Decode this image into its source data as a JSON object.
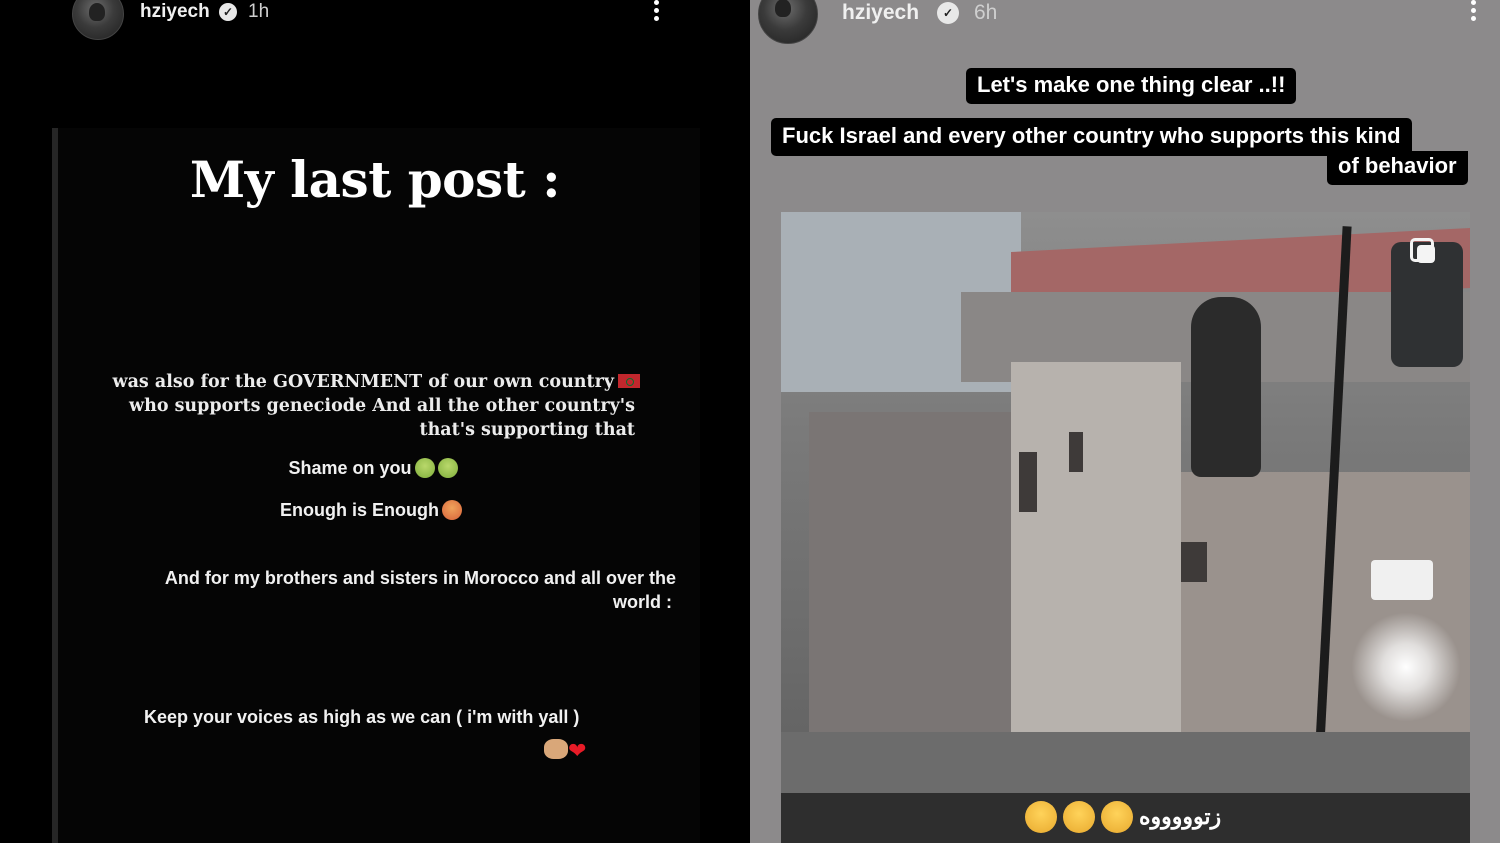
{
  "left_story": {
    "username": "hziyech",
    "time": "1h",
    "title": "My last post  :",
    "paragraph_lines": [
      "was also for the GOVERNMENT of our own country",
      "who supports geneciode  And all the other country's",
      "that's supporting that"
    ],
    "shame_text": "Shame on you",
    "enough_text": "Enough is Enough",
    "brothers_lines": [
      "And for my brothers and sisters in Morocco and all over the",
      "world  :"
    ],
    "voices_text": "Keep your voices as high as we can  ( i'm with yall )"
  },
  "right_story": {
    "username": "hziyech",
    "time": "6h",
    "caption_1": "Let's make one thing clear ..!!",
    "caption_2_line_1": "Fuck Israel and every other  country who supports this kind",
    "caption_2_line_2": "of behavior",
    "video_caption_text": "زتوووووه"
  },
  "icons": {
    "verified": "verified-badge-icon",
    "more": "more-options-icon",
    "flag": "morocco-flag-icon",
    "copy": "multiple-media-icon"
  },
  "colors": {
    "left_background": "#000000",
    "right_background": "#8c8a8b",
    "caption_background": "#000000"
  }
}
